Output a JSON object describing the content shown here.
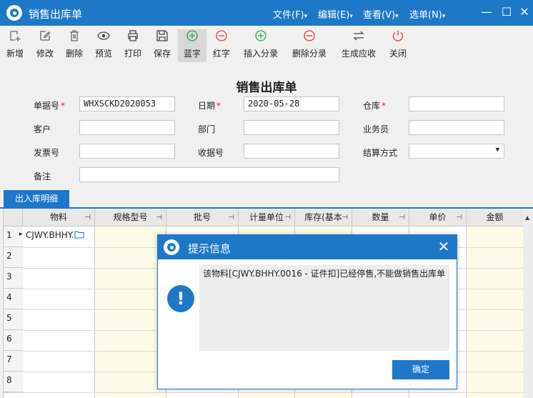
{
  "window": {
    "title": "销售出库单",
    "menus": [
      "文件(F)",
      "编辑(E)",
      "查看(V)",
      "选单(N)"
    ],
    "menu_arrow": "▾",
    "controls": {
      "minimize": "—",
      "maximize": "☐",
      "close": "✕"
    }
  },
  "toolbar": {
    "items": [
      {
        "label": "新增",
        "icon": "new-icon"
      },
      {
        "label": "修改",
        "icon": "edit-icon"
      },
      {
        "label": "删除",
        "icon": "trash-icon"
      },
      {
        "label": "预览",
        "icon": "eye-icon"
      },
      {
        "label": "打印",
        "icon": "printer-icon"
      },
      {
        "label": "保存",
        "icon": "save-icon"
      },
      {
        "label": "蓝字",
        "icon": "plus-circle-icon"
      },
      {
        "label": "红字",
        "icon": "minus-circle-icon"
      },
      {
        "label": "插入分录",
        "icon": "plus-circle-icon"
      },
      {
        "label": "删除分录",
        "icon": "minus-circle-icon"
      },
      {
        "label": "生成应收",
        "icon": "swap-icon"
      },
      {
        "label": "关闭",
        "icon": "power-icon"
      }
    ]
  },
  "form": {
    "title": "销售出库单",
    "required_mark": "*",
    "fields": {
      "bill_no": {
        "label": "单据号",
        "value": "WHXSCKD2020053"
      },
      "date": {
        "label": "日期",
        "value": "2020-05-28"
      },
      "warehouse": {
        "label": "仓库",
        "value": ""
      },
      "customer": {
        "label": "客户",
        "value": ""
      },
      "department": {
        "label": "部门",
        "value": ""
      },
      "salesman": {
        "label": "业务员",
        "value": ""
      },
      "invoice_no": {
        "label": "发票号",
        "value": ""
      },
      "receipt_no": {
        "label": "收据号",
        "value": ""
      },
      "settlement": {
        "label": "结算方式",
        "value": ""
      },
      "remark": {
        "label": "备注",
        "value": ""
      }
    }
  },
  "tabs": [
    {
      "label": "出入库明细"
    }
  ],
  "grid": {
    "columns": [
      "物料",
      "规格型号",
      "批号",
      "计量单位",
      "库存(基本",
      "数量",
      "单价",
      "金额"
    ],
    "row_numbers": [
      "1",
      "2",
      "3",
      "4",
      "5",
      "6",
      "7",
      "8"
    ],
    "rows": [
      {
        "material": "CJWY.BHHY."
      }
    ]
  },
  "dialog": {
    "title": "提示信息",
    "message": "该物料[CJWY.BHHY.0016 - 证件扣]已经停售,不能做销售出库单",
    "ok_label": "确定"
  },
  "colors": {
    "accent": "#1e78c8",
    "required": "#e02020",
    "add": "#2aa84a",
    "remove": "#e04040"
  }
}
